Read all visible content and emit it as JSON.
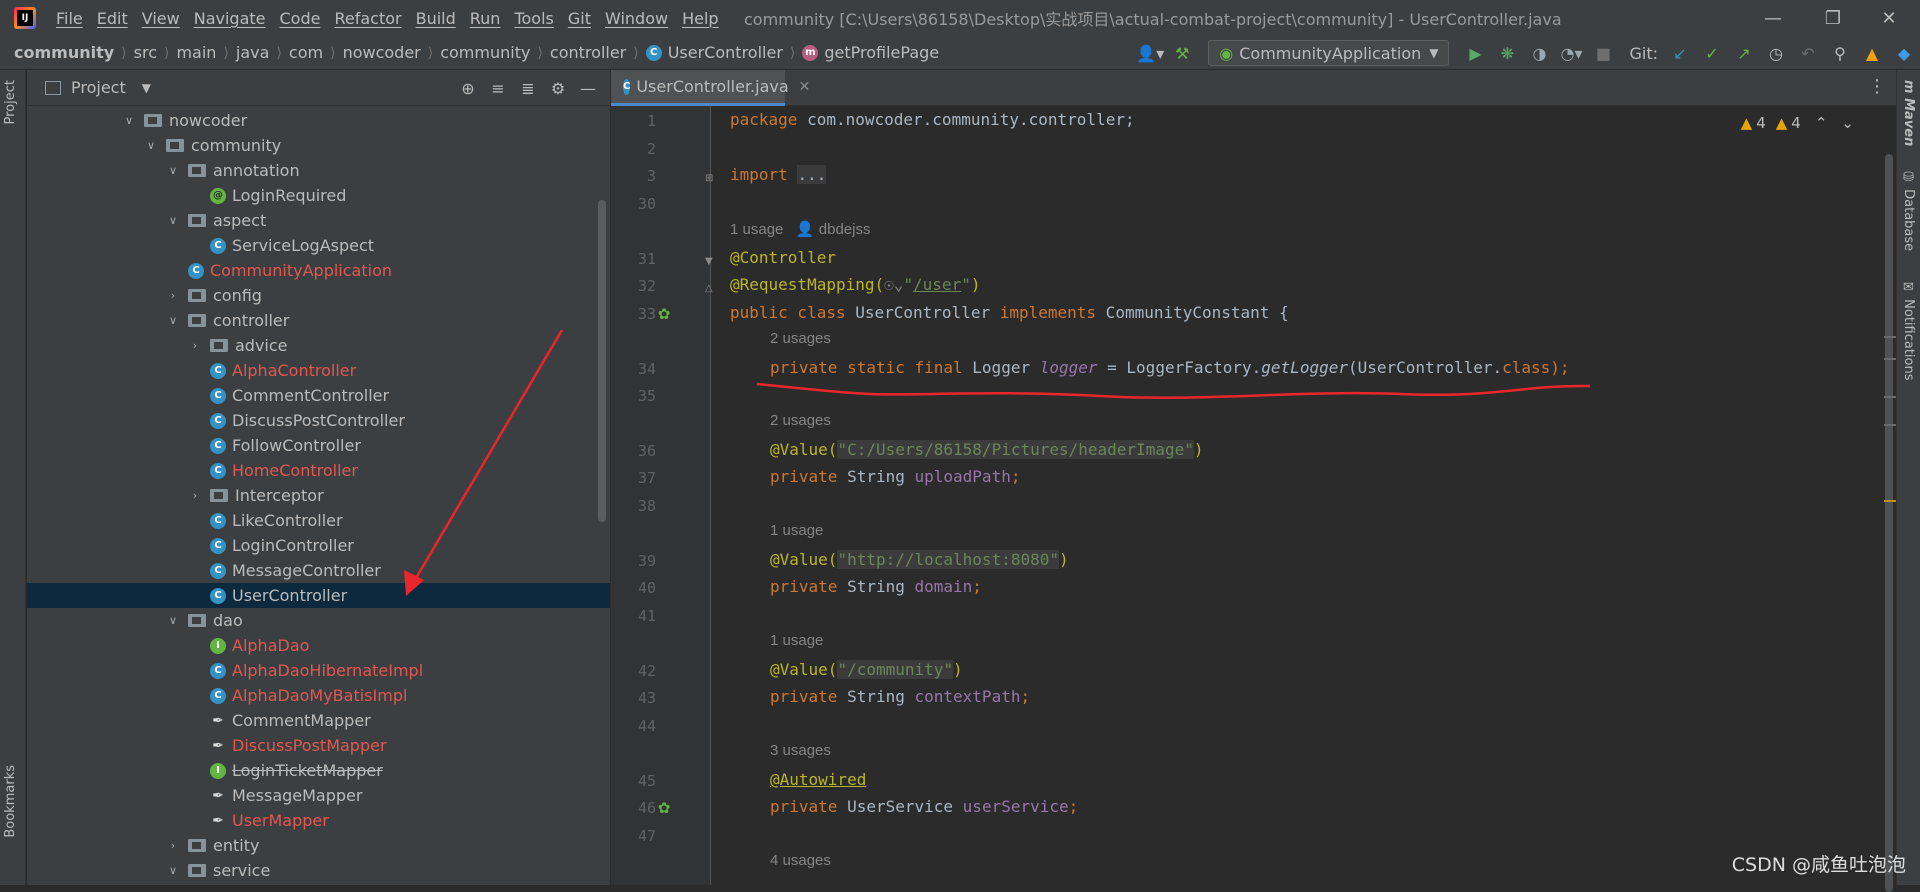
{
  "menubar": {
    "items": [
      "File",
      "Edit",
      "View",
      "Navigate",
      "Code",
      "Refactor",
      "Build",
      "Run",
      "Tools",
      "Git",
      "Window",
      "Help"
    ],
    "window_title": "community [C:\\Users\\86158\\Desktop\\实战项目\\actual-combat-project\\community] - UserController.java"
  },
  "breadcrumb": [
    "community",
    "src",
    "main",
    "java",
    "com",
    "nowcoder",
    "community",
    "controller",
    "UserController",
    "getProfilePage"
  ],
  "toolbar": {
    "run_config": "CommunityApplication",
    "git_label": "Git:"
  },
  "left_strip": {
    "project": "Project",
    "bookmarks": "Bookmarks"
  },
  "right_strip": {
    "maven": "Maven",
    "database": "Database",
    "notifications": "Notifications"
  },
  "project_panel": {
    "title": "Project",
    "tree": [
      {
        "label": "nowcoder",
        "type": "folder",
        "arrow": "open",
        "level": 0
      },
      {
        "label": "community",
        "type": "folder",
        "arrow": "open",
        "level": 1
      },
      {
        "label": "annotation",
        "type": "folder",
        "arrow": "open",
        "level": 2
      },
      {
        "label": "LoginRequired",
        "type": "annotation",
        "level": 3
      },
      {
        "label": "aspect",
        "type": "folder",
        "arrow": "open",
        "level": 2
      },
      {
        "label": "ServiceLogAspect",
        "type": "class",
        "level": 3
      },
      {
        "label": "CommunityApplication",
        "type": "app",
        "level": 2,
        "red": true
      },
      {
        "label": "config",
        "type": "folder",
        "arrow": "closed",
        "level": 2
      },
      {
        "label": "controller",
        "type": "folder",
        "arrow": "open",
        "level": 2
      },
      {
        "label": "advice",
        "type": "folder",
        "arrow": "closed",
        "level": 3
      },
      {
        "label": "AlphaController",
        "type": "class",
        "level": 3,
        "red": true
      },
      {
        "label": "CommentController",
        "type": "class",
        "level": 3
      },
      {
        "label": "DiscussPostController",
        "type": "class",
        "level": 3
      },
      {
        "label": "FollowController",
        "type": "class",
        "level": 3
      },
      {
        "label": "HomeController",
        "type": "class",
        "level": 3,
        "red": true
      },
      {
        "label": "Interceptor",
        "type": "folder",
        "arrow": "closed",
        "level": 3
      },
      {
        "label": "LikeController",
        "type": "class",
        "level": 3
      },
      {
        "label": "LoginController",
        "type": "class",
        "level": 3
      },
      {
        "label": "MessageController",
        "type": "class",
        "level": 3
      },
      {
        "label": "UserController",
        "type": "class",
        "level": 3,
        "selected": true
      },
      {
        "label": "dao",
        "type": "folder",
        "arrow": "open",
        "level": 2
      },
      {
        "label": "AlphaDao",
        "type": "interface",
        "level": 3,
        "red": true
      },
      {
        "label": "AlphaDaoHibernateImpl",
        "type": "class",
        "level": 3,
        "red": true
      },
      {
        "label": "AlphaDaoMyBatisImpl",
        "type": "class",
        "level": 3,
        "red": true
      },
      {
        "label": "CommentMapper",
        "type": "mapper",
        "level": 3
      },
      {
        "label": "DiscussPostMapper",
        "type": "mapper",
        "level": 3,
        "red": true
      },
      {
        "label": "LoginTicketMapper",
        "type": "interface",
        "level": 3,
        "strike": true
      },
      {
        "label": "MessageMapper",
        "type": "mapper",
        "level": 3
      },
      {
        "label": "UserMapper",
        "type": "mapper",
        "level": 3,
        "red": true
      },
      {
        "label": "entity",
        "type": "folder",
        "arrow": "closed",
        "level": 2
      },
      {
        "label": "service",
        "type": "folder",
        "arrow": "open",
        "level": 2
      }
    ]
  },
  "editor": {
    "tab_label": "UserController.java",
    "warnings_a": "4",
    "warnings_b": "4",
    "line_numbers": [
      "1",
      "2",
      "3",
      "30",
      "31",
      "32",
      "33",
      "34",
      "35",
      "36",
      "37",
      "38",
      "39",
      "40",
      "41",
      "42",
      "43",
      "44",
      "45",
      "46",
      "47"
    ],
    "hints": {
      "h1": "1 usage",
      "author": "dbdejss",
      "h2": "2 usages",
      "h3": "2 usages",
      "h4": "1 usage",
      "h5": "1 usage",
      "h6": "3 usages",
      "h7": "4 usages"
    },
    "code": {
      "l1_kw": "package",
      "l1_rest": " com.nowcoder.community.controller;",
      "l3_kw": "import",
      "l3_fold": "...",
      "l31": "@Controller",
      "l32_ann": "@RequestMapping(",
      "l32_str_open": "\"",
      "l32_path": "/user",
      "l32_str_close": "\"",
      "l32_end": ")",
      "l33_kw1": "public class",
      "l33_name": " UserController ",
      "l33_kw2": "implements",
      "l33_rest": " CommunityConstant {",
      "l34_kw": "private static final",
      "l34_type": " Logger ",
      "l34_field": "logger",
      "l34_mid": " = LoggerFactory.",
      "l34_method": "getLogger",
      "l34_arg": "(UserController.",
      "l34_class": "class",
      "l34_end": ");",
      "l36_ann": "@Value(",
      "l36_str": "\"C:/Users/86158/Pictures/headerImage\"",
      "l36_end": ")",
      "l37_kw": "private",
      "l37_type": " String ",
      "l37_field": "uploadPath",
      "l37_end": ";",
      "l39_ann": "@Value(",
      "l39_str": "\"http://localhost:8080\"",
      "l39_end": ")",
      "l40_kw": "private",
      "l40_type": " String ",
      "l40_field": "domain",
      "l40_end": ";",
      "l42_ann": "@Value(",
      "l42_str": "\"/community\"",
      "l42_end": ")",
      "l43_kw": "private",
      "l43_type": " String ",
      "l43_field": "contextPath",
      "l43_end": ";",
      "l45_ann": "@Autowired",
      "l46_kw": "private",
      "l46_type": " UserService ",
      "l46_field": "userService",
      "l46_end": ";"
    }
  },
  "watermark": "CSDN @咸鱼吐泡泡",
  "colors": {
    "keyword": "#cc7832",
    "annotation": "#bbb529",
    "string": "#6a8759",
    "field": "#9876aa",
    "selection": "#0d293e",
    "callout": "#e8262b"
  }
}
